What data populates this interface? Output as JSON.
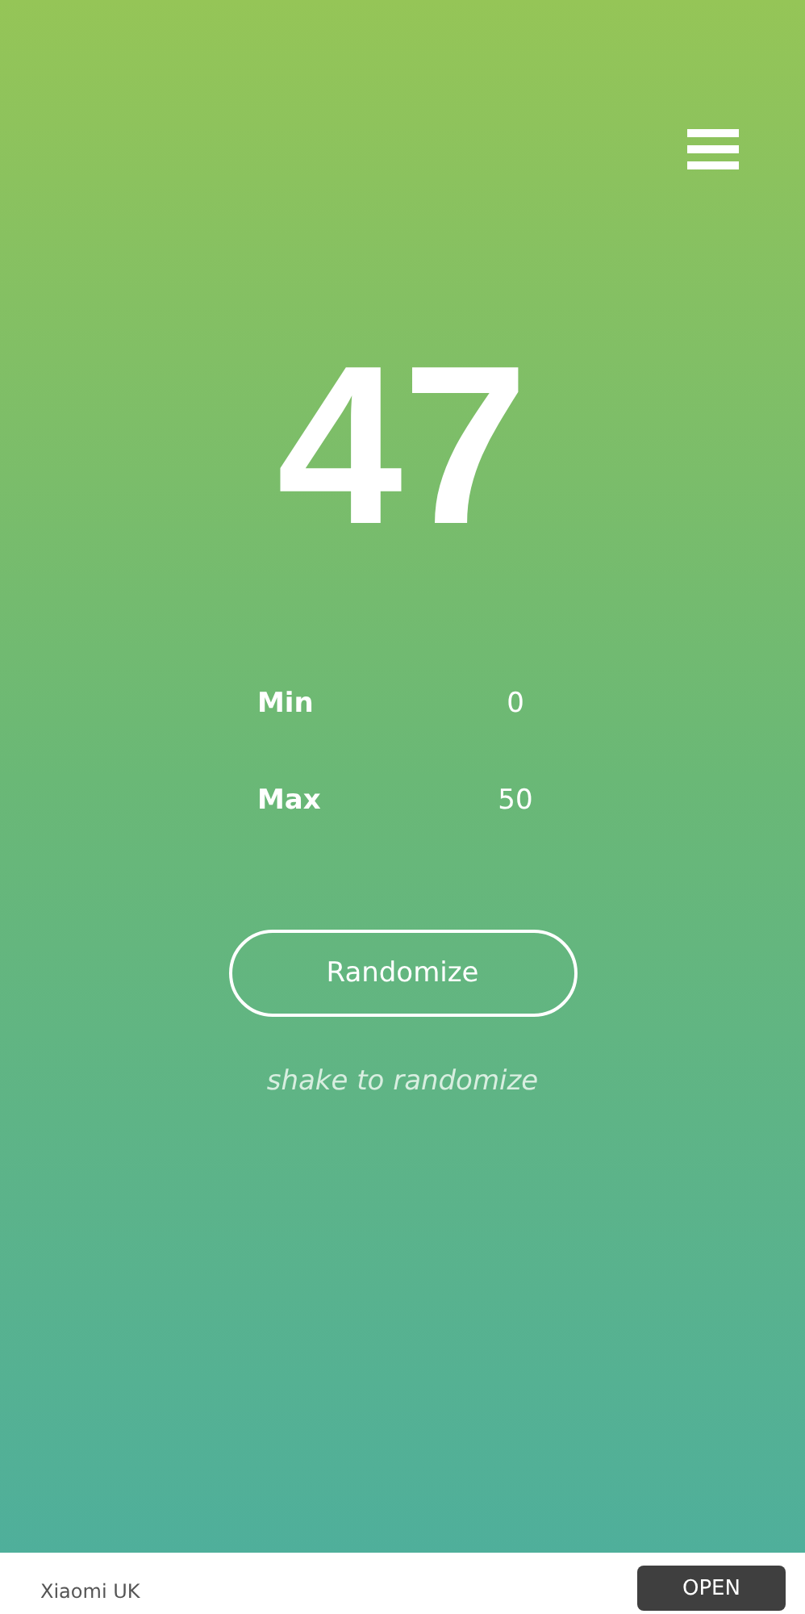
{
  "result": "47",
  "fields": [
    {
      "label": "Min",
      "value": "0"
    },
    {
      "label": "Max",
      "value": "50"
    }
  ],
  "button": "Randomize",
  "hint": "shake to randomize",
  "ad": {
    "advertiser": "Xiaomi UK",
    "action": "OPEN"
  }
}
